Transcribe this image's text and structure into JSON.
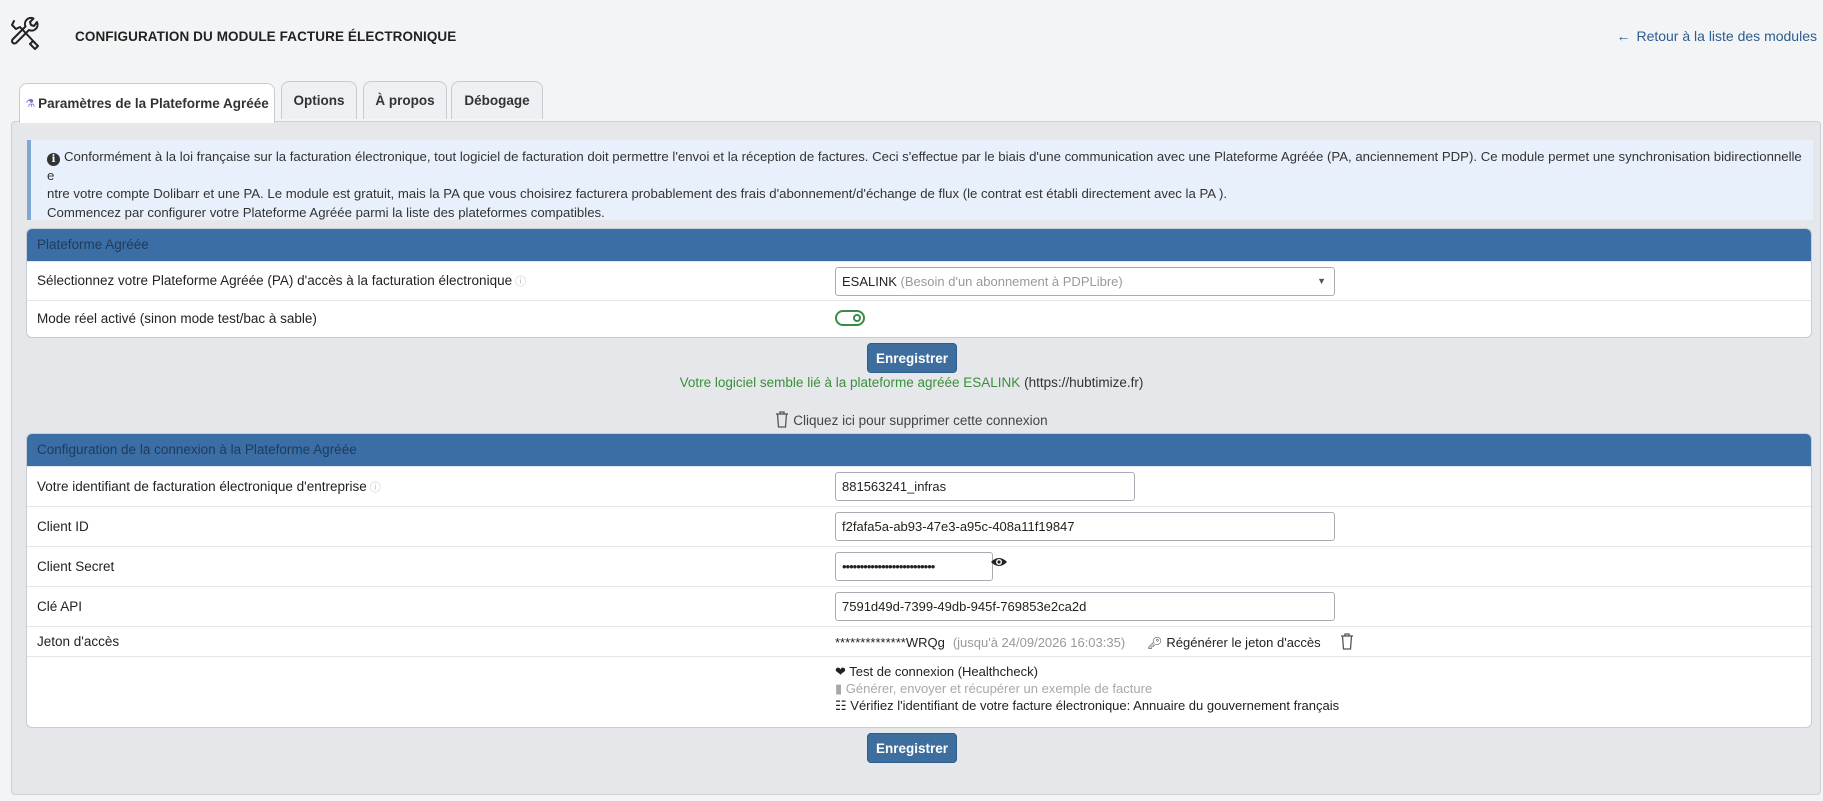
{
  "header": {
    "title": "CONFIGURATION DU MODULE FACTURE ÉLECTRONIQUE",
    "back_link": "Retour à la liste des modules"
  },
  "tabs": [
    {
      "label": "Paramètres de la Plateforme Agréée",
      "active": true
    },
    {
      "label": "Options"
    },
    {
      "label": "À propos"
    },
    {
      "label": "Débogage"
    }
  ],
  "info": {
    "line1": "Conformément à la loi française sur la facturation électronique, tout logiciel de facturation doit permettre l'envoi et la réception de factures. Ceci s'effectue par le biais d'une communication avec une Plateforme Agréée (PA, anciennement PDP). Ce module permet une synchronisation bidirectionnelle e",
    "line2": "ntre votre compte Dolibarr et une PA. Le module est gratuit, mais la PA que vous choisirez facturera probablement des frais d'abonnement/d'échange de flux (le contrat est établi directement avec la PA ).",
    "line3": "Commencez par configurer votre Plateforme Agréée parmi la liste des plateformes compatibles."
  },
  "pa_section": {
    "title": "Plateforme Agréée",
    "select_label": "Sélectionnez votre Plateforme Agréée (PA) d'accès à la facturation électronique",
    "select_value": "ESALINK",
    "select_hint": "(Besoin d'un abonnement à PDPLibre)",
    "mode_label": "Mode réel activé (sinon mode test/bac à sable)",
    "mode_on": true
  },
  "save_label": "Enregistrer",
  "status": {
    "text": "Votre logiciel semble lié à la plateforme agréée ESALINK",
    "url": "(https://hubtimize.fr)"
  },
  "delete_link": "Cliquez ici pour supprimer cette connexion",
  "conn_section": {
    "title": "Configuration de la connexion à la Plateforme Agréée",
    "id_label": "Votre identifiant de facturation électronique d'entreprise",
    "id_value": "881563241_infras",
    "client_id_label": "Client ID",
    "client_id_value": "f2fafa5a-ab93-47e3-a95c-408a11f19847",
    "client_secret_label": "Client Secret",
    "client_secret_value": "••••••••••••••••••••••••••",
    "api_key_label": "Clé API",
    "api_key_value": "7591d49d-7399-49db-945f-769853e2ca2d",
    "token_label": "Jeton d'accès",
    "token_value": "**************WRQg",
    "token_expiry": "(jusqu'à 24/09/2026 16:03:35)",
    "regen_label": "Régénérer le jeton d'accès",
    "healthcheck": "Test de connexion (Healthcheck)",
    "example": "Générer, envoyer et récupérer un exemple de facture",
    "verify": "Vérifiez l'identifiant de votre facture électronique: Annuaire du gouvernement français"
  },
  "colors": {
    "header_bar": "#3a6ea5",
    "button": "#3e6e9e",
    "status_green": "#3b8f3a",
    "info_bg": "#e8f1fb"
  }
}
